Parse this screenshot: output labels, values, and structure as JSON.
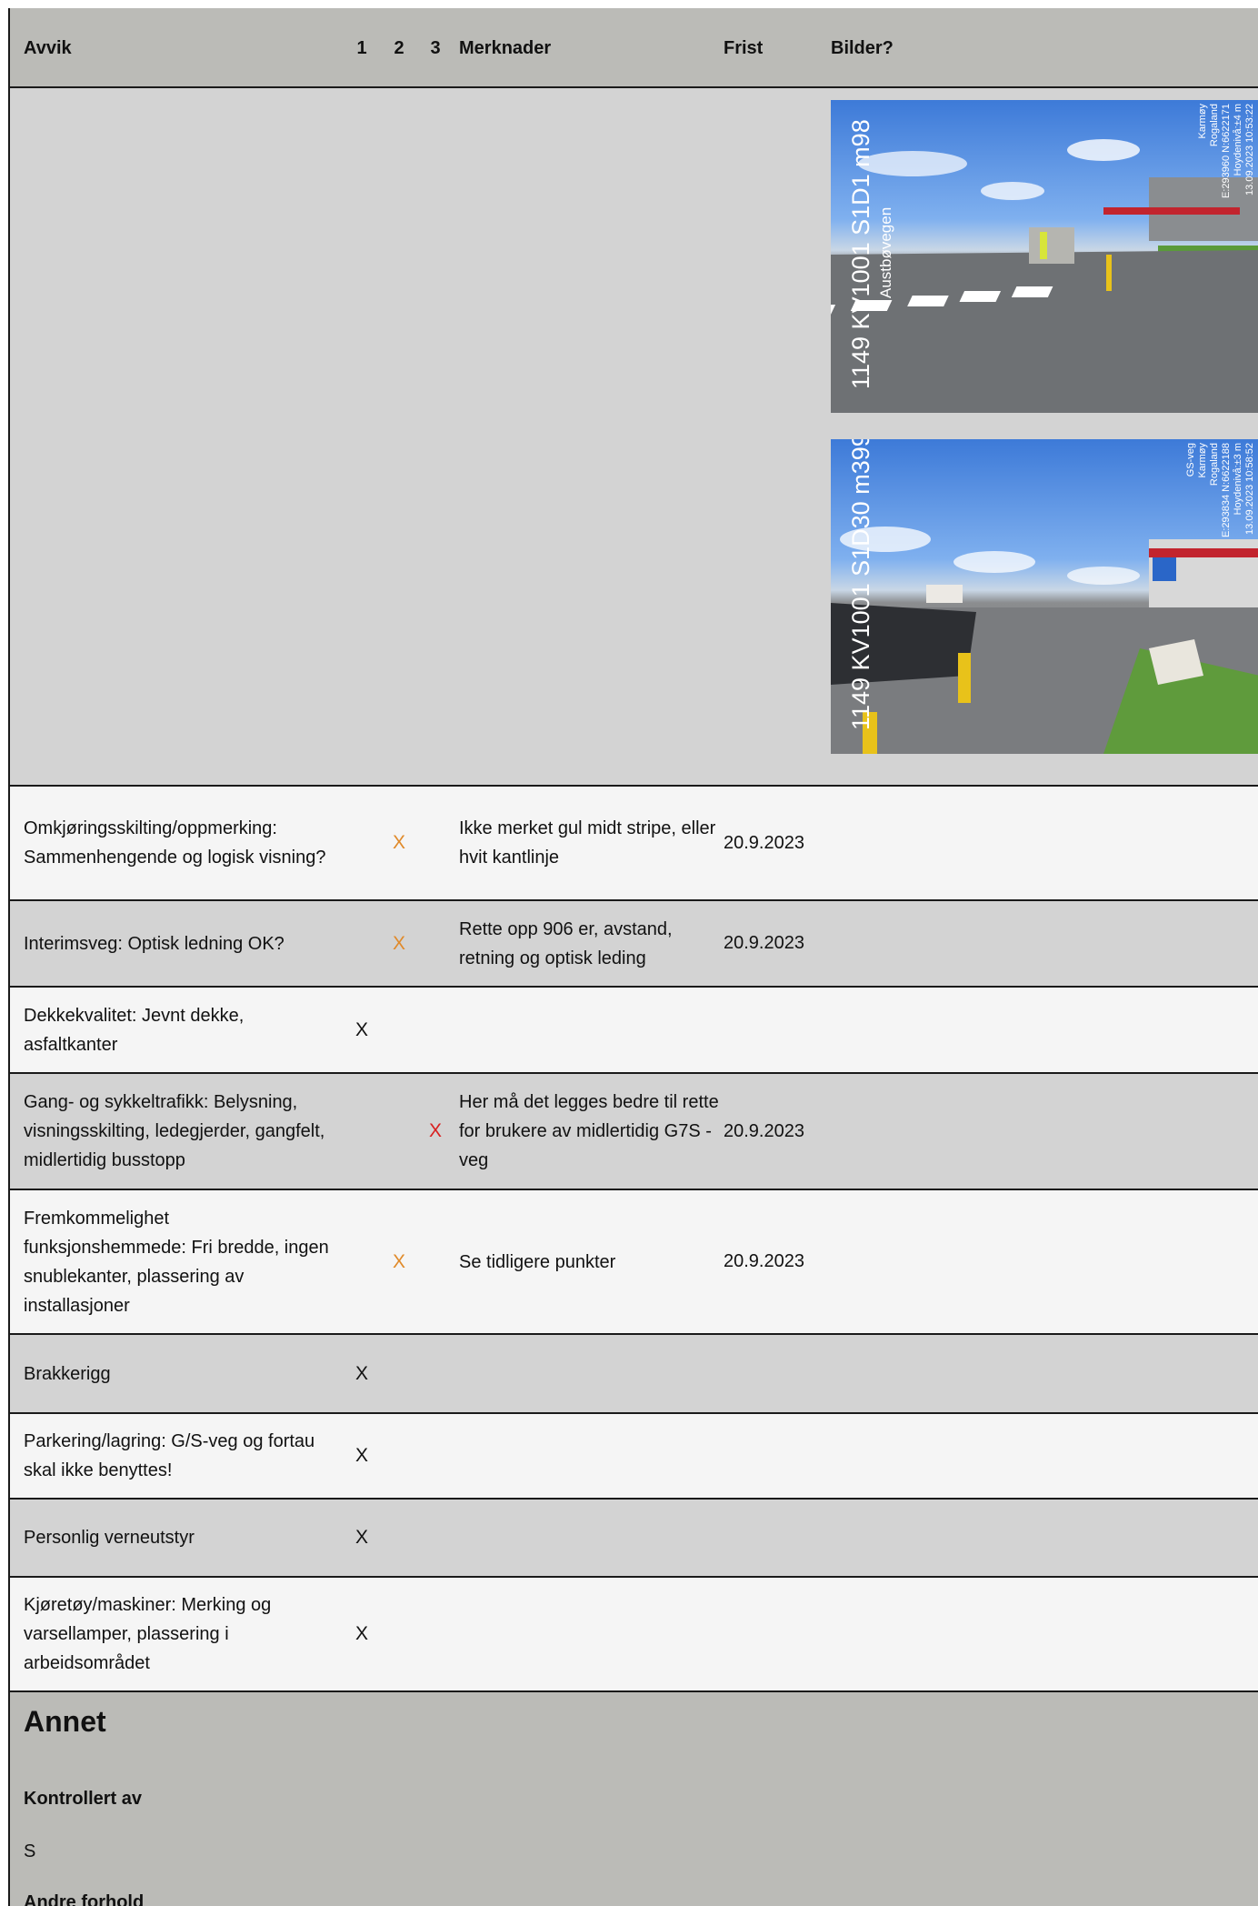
{
  "header": {
    "avvik": "Avvik",
    "col1": "1",
    "col2": "2",
    "col3": "3",
    "merknader": "Merknader",
    "frist": "Frist",
    "bilder": "Bilder?"
  },
  "photos": [
    {
      "caption_main": "1149 KV1001 S1D1 m98",
      "caption_sub": "Austbøvegen",
      "meta": [
        "Karmøy",
        "Rogaland",
        "E:293960 N:6622171",
        "Hoydenivå:±4 m",
        "13.09.2023 10:53:22"
      ]
    },
    {
      "caption_main": "1149 KV1001 S1D30 m399",
      "caption_sub": "",
      "meta": [
        "GS-veg",
        "Karmøy",
        "Rogaland",
        "E:293834 N:6622188",
        "Hoydenivå:±3 m",
        "13.09.2023 10:58:52"
      ]
    }
  ],
  "rows": [
    {
      "avvik": "Omkjøringsskilting/oppmerking: Sammenhengende og logisk visning?",
      "c1": "",
      "c2": "X",
      "c3": "",
      "merknader": "Ikke merket gul midt stripe, eller hvit kantlinje",
      "frist": "20.9.2023"
    },
    {
      "avvik": "Interimsveg: Optisk ledning OK?",
      "c1": "",
      "c2": "X",
      "c3": "",
      "merknader": "Rette opp 906 er, avstand, retning og optisk leding",
      "frist": "20.9.2023"
    },
    {
      "avvik": "Dekkekvalitet: Jevnt dekke, asfaltkanter",
      "c1": "X",
      "c2": "",
      "c3": "",
      "merknader": "",
      "frist": ""
    },
    {
      "avvik": "Gang- og sykkeltrafikk: Belysning, visningsskilting, ledegjerder, gangfelt, midlertidig busstopp",
      "c1": "",
      "c2": "",
      "c3": "X",
      "merknader": "Her må det legges bedre til rette for brukere av midlertidig G7S - veg",
      "frist": "20.9.2023"
    },
    {
      "avvik": "Fremkommelighet funksjonshemmede: Fri bredde, ingen snublekanter, plassering av installasjoner",
      "c1": "",
      "c2": "X",
      "c3": "",
      "merknader": "Se tidligere punkter",
      "frist": "20.9.2023"
    },
    {
      "avvik": "Brakkerigg",
      "c1": "X",
      "c2": "",
      "c3": "",
      "merknader": "",
      "frist": ""
    },
    {
      "avvik": "Parkering/lagring: G/S-veg og fortau skal ikke benyttes!",
      "c1": "X",
      "c2": "",
      "c3": "",
      "merknader": "",
      "frist": ""
    },
    {
      "avvik": "Personlig verneutstyr",
      "c1": "X",
      "c2": "",
      "c3": "",
      "merknader": "",
      "frist": ""
    },
    {
      "avvik": "Kjøretøy/maskiner: Merking og varsellamper, plassering i arbeidsområdet",
      "c1": "X",
      "c2": "",
      "c3": "",
      "merknader": "",
      "frist": ""
    }
  ],
  "annet": {
    "title": "Annet",
    "kontrollert_label": "Kontrollert av",
    "kontrollert_value": "S",
    "andre_label": "Andre forhold"
  },
  "colors": {
    "header_bg": "#bbbbb7",
    "row_light": "#f5f5f5",
    "row_dark": "#d3d3d3",
    "mark_orange": "#e08a2a",
    "mark_red": "#d81f1f"
  }
}
